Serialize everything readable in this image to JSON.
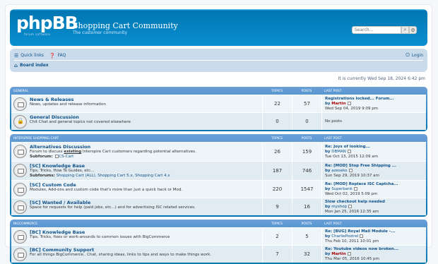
{
  "header": {
    "logo": "phpBB",
    "logo_sub": "forum  software",
    "site_title": "Shopping Cart Community",
    "site_desc": "The customer community",
    "search_placeholder": "Search…"
  },
  "nav": {
    "quick_links": "Quick links",
    "faq": "FAQ",
    "login": "Login",
    "board_index": "Board index"
  },
  "datetime": "It is currently Wed Sep 18, 2024 6:42 pm",
  "columns": {
    "topics": "TOPICS",
    "posts": "POSTS",
    "last_post": "LAST POST"
  },
  "categories": [
    {
      "name": "GENERAL",
      "forums": [
        {
          "title": "News & Releases",
          "desc": "News, updates and release information",
          "topics": "22",
          "posts": "57",
          "lp_title": "Registrations locked... Forum...",
          "lp_by": "by",
          "lp_user": "Martin",
          "lp_date": "Wed Sep 04, 2019 9:09 pm"
        },
        {
          "title": "General Discussion",
          "desc": "Chit Chat and general topics not covered elsewhere",
          "topics": "0",
          "posts": "0",
          "lp_title": "No posts",
          "lp_by": "",
          "lp_user": "",
          "lp_date": ""
        }
      ]
    },
    {
      "name": "INTERSPIRE SHOPPING CART",
      "forums": [
        {
          "title": "Alternatives Discussion",
          "desc_pre": "Forum to discuss ",
          "desc_u": "existing",
          "desc_post": " Interspire Cart customers regarding potential alternatives.",
          "sub_label": "Subforum:",
          "sub_links": "CS-Cart",
          "topics": "26",
          "posts": "159",
          "lp_title": "Re: Joys of looking...",
          "lp_by": "by",
          "lp_user": "DBMAN",
          "lp_date": "Tue Oct 13, 2015 12:09 am"
        },
        {
          "title": "[SC] Knowledge Base",
          "desc": "Tips, Tricks, How To Guides, etc...",
          "sub_label": "Subforums:",
          "sub_links": "Shopping Cart (ALL), Shopping Cart 5.x, Shopping Cart 4.x",
          "topics": "187",
          "posts": "746",
          "lp_title": "Re: [MOD] Stop Free Shipping ...",
          "lp_by": "by",
          "lp_user": "azeseko",
          "lp_date": "Sun Sep 29, 2019 10:37 am"
        },
        {
          "title": "[SC] Custom Code",
          "desc": "Modules, Add-ons and custom code that's more than just a quick hack or Mod.",
          "topics": "220",
          "posts": "1547",
          "lp_title": "Re: [MOD] Replace ISC Captcha...",
          "lp_by": "by",
          "lp_user": "Superbank",
          "lp_date": "Wed Oct 02, 2019 5:09 pm"
        },
        {
          "title": "[SC] Wanted / Available",
          "desc": "Space for requests for help (paid jobs, etc...) and for advertising ISC related services.",
          "topics": "9",
          "posts": "16",
          "lp_title": "Slow checkout help needed",
          "lp_by": "by",
          "lp_user": "myshop",
          "lp_date": "Mon Jan 25, 2016 12:35 am"
        }
      ]
    },
    {
      "name": "BIGCOMMERCE",
      "forums": [
        {
          "title": "[BC] Knowledge Base",
          "desc": "Tips, Tricks, fixes or work-arounds to common issues with BigCommerce",
          "topics": "2",
          "posts": "5",
          "lp_title": "Re: [BUG] Royal Mail Module -...",
          "lp_by": "by",
          "lp_user": "CharliePostrel",
          "lp_date": "Thu Feb 10, 2011 10:01 pm"
        },
        {
          "title": "[BC] Community Support",
          "desc": "For all things BigCommerce.. Chat, sharing ideas, links to tips and ways to make things work.",
          "topics": "7",
          "posts": "32",
          "lp_title": "Re: Youtube videos now broken...",
          "lp_by": "by",
          "lp_user": "Martin",
          "lp_date": "Thu Mar 05, 2016 10:45 pm"
        }
      ]
    }
  ]
}
